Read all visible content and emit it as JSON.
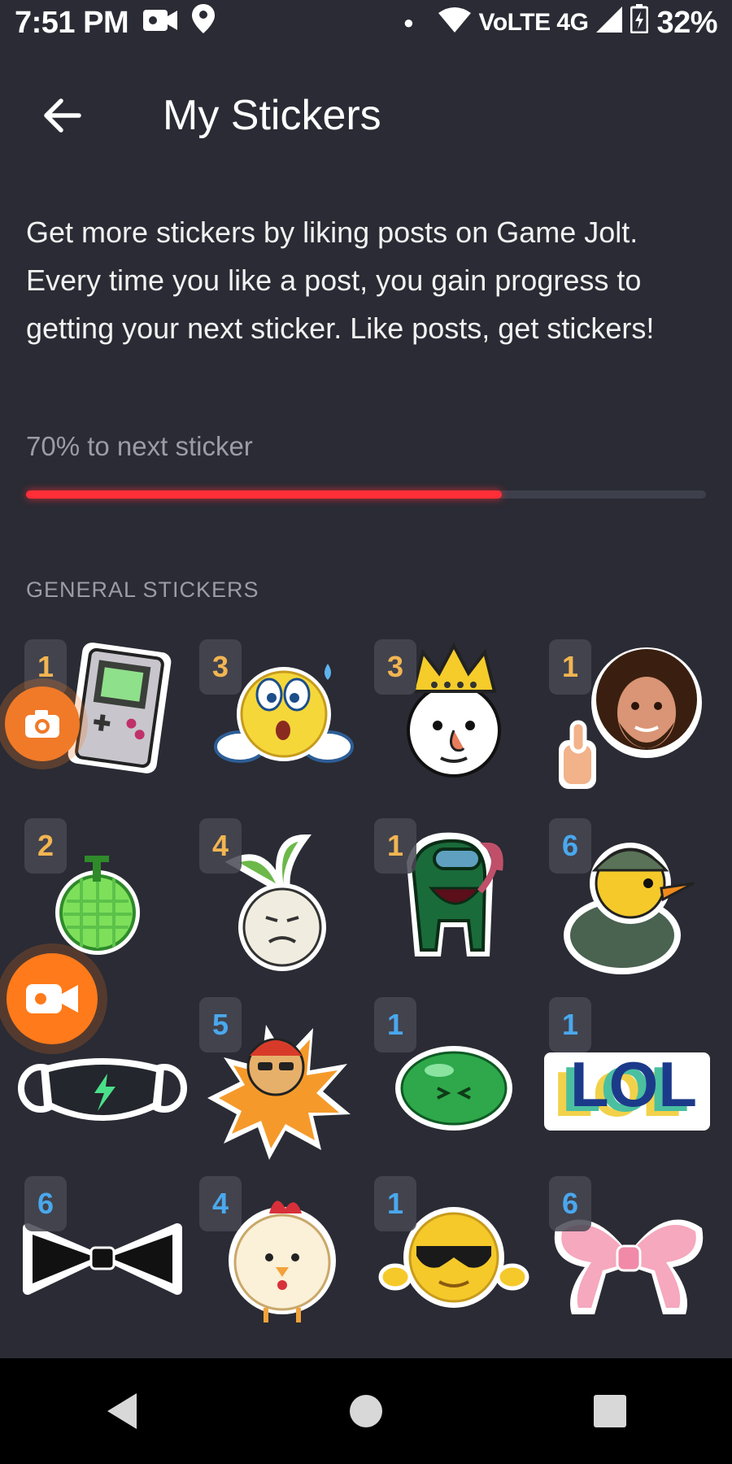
{
  "status_bar": {
    "time": "7:51 PM",
    "network": "VoLTE 4G",
    "battery": "32%",
    "icons": [
      "video-camera-icon",
      "location-pin-icon",
      "notification-dot-icon",
      "wifi-icon",
      "signal-icon",
      "battery-icon"
    ]
  },
  "header": {
    "title": "My Stickers",
    "back_icon": "arrow-left-icon"
  },
  "intro": {
    "text": "Get more stickers by liking posts on Game Jolt. Every time you like a post, you gain progress to getting your next sticker. Like posts, get stickers!"
  },
  "progress": {
    "label": "70% to next sticker",
    "percent": 70,
    "bar_color": "#ff2e37"
  },
  "section": {
    "title": "GENERAL STICKERS"
  },
  "stickers": [
    {
      "count": "1",
      "icon": "gameboy-sticker"
    },
    {
      "count": "3",
      "icon": "surprised-emoji-sticker"
    },
    {
      "count": "3",
      "icon": "crowned-face-sticker"
    },
    {
      "count": "1",
      "icon": "painter-thumbs-up-sticker"
    },
    {
      "count": "2",
      "icon": "melon-sticker"
    },
    {
      "count": "4",
      "icon": "radish-sticker"
    },
    {
      "count": "1",
      "icon": "green-crewmate-sticker"
    },
    {
      "count": "6",
      "icon": "duck-soldier-sticker"
    },
    {
      "count": "",
      "icon": "face-mask-sticker"
    },
    {
      "count": "5",
      "icon": "salt-sticker"
    },
    {
      "count": "1",
      "icon": "green-slime-sticker"
    },
    {
      "count": "1",
      "icon": "lol-text-sticker"
    },
    {
      "count": "6",
      "icon": "black-bowtie-sticker"
    },
    {
      "count": "4",
      "icon": "chicken-sticker"
    },
    {
      "count": "1",
      "icon": "sunglasses-emoji-sticker"
    },
    {
      "count": "6",
      "icon": "pink-bow-sticker"
    }
  ],
  "colors": {
    "background": "#2a2b34",
    "count_gold": "#f2b552",
    "count_blue": "#4aa8ee",
    "fab_orange": "#ff7a1a"
  },
  "overlays": {
    "camera_fab_icon": "camera-icon",
    "record_fab_icon": "video-record-icon"
  },
  "nav_bar": {
    "icons": [
      "back-triangle-icon",
      "home-circle-icon",
      "recents-square-icon"
    ]
  }
}
